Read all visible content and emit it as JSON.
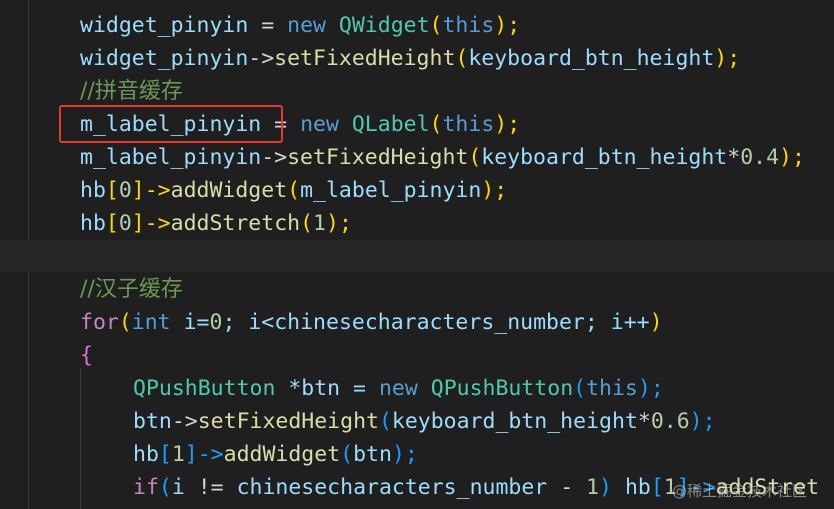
{
  "colors": {
    "background": "#1f1f1f",
    "variable": "#9cdcfe",
    "keyword": "#569cd6",
    "control_keyword": "#c586c0",
    "type": "#4ec9b0",
    "function": "#dcdcaa",
    "number": "#b5cea8",
    "comment": "#6a9955",
    "highlight_box": "#e23b2e"
  },
  "code": {
    "l1": {
      "a": "widget_pinyin",
      "b": " = ",
      "c": "new",
      "d": " ",
      "e": "QWidget",
      "f": "(",
      "g": "this",
      "h": ");"
    },
    "l2": {
      "a": "widget_pinyin",
      "b": "->",
      "c": "setFixedHeight",
      "d": "(",
      "e": "keyboard_btn_height",
      "f": ");"
    },
    "l3": {
      "comment": "//拼音缓存"
    },
    "l4": {
      "a": "m_label_pinyin",
      "b": " = ",
      "c": "new",
      "d": " ",
      "e": "QLabel",
      "f": "(",
      "g": "this",
      "h": ");"
    },
    "l5": {
      "a": "m_label_pinyin",
      "b": "->",
      "c": "setFixedHeight",
      "d": "(",
      "e": "keyboard_btn_height",
      "f": "*",
      "g": "0.4",
      "h": ");"
    },
    "l6": {
      "a": "hb",
      "b": "[",
      "c": "0",
      "d": "]->",
      "e": "addWidget",
      "f": "(",
      "g": "m_label_pinyin",
      "h": ");"
    },
    "l7": {
      "a": "hb",
      "b": "[",
      "c": "0",
      "d": "]->",
      "e": "addStretch",
      "f": "(",
      "g": "1",
      "h": ");"
    },
    "l8": {
      "comment": "//汉子缓存"
    },
    "l9": {
      "a": "for",
      "b": "(",
      "c": "int",
      "d": " i=",
      "e": "0",
      "f": "; i<",
      "g": "chinesecharacters_number",
      "h": "; i++",
      "i": ")"
    },
    "l10": {
      "a": "{"
    },
    "l11": {
      "a": "QPushButton",
      "b": " *btn = ",
      "c": "new",
      "d": " ",
      "e": "QPushButton",
      "f": "(",
      "g": "this",
      "h": ");"
    },
    "l12": {
      "a": "btn",
      "b": "->",
      "c": "setFixedHeight",
      "d": "(",
      "e": "keyboard_btn_height",
      "f": "*",
      "g": "0.6",
      "h": ");"
    },
    "l13": {
      "a": "hb",
      "b": "[",
      "c": "1",
      "d": "]->",
      "e": "addWidget",
      "f": "(",
      "g": "btn",
      "h": ");"
    },
    "l14": {
      "a": "if",
      "b": "(",
      "c": "i",
      "d": " != ",
      "e": "chinesecharacters_number",
      "f": " - ",
      "g": "1",
      "h": ") ",
      "i": "hb",
      "j": "[",
      "k": "1",
      "l": "]->",
      "m": "addStret"
    }
  },
  "watermark": "@稀土掘金技术社区"
}
